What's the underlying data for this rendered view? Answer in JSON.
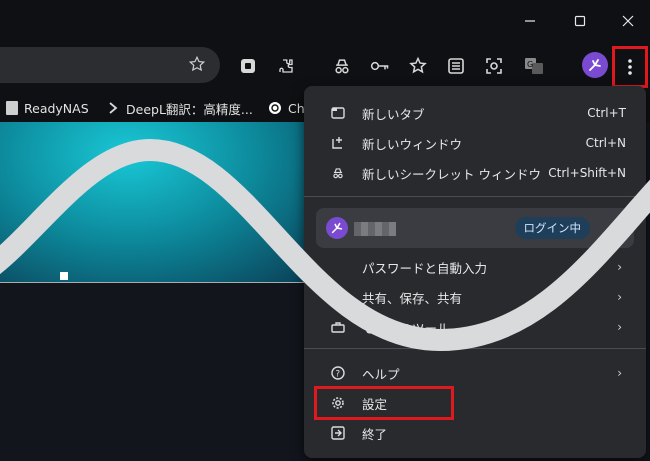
{
  "window_controls": {
    "minimize_icon": "minimize-icon",
    "maximize_icon": "maximize-icon",
    "close_icon": "close-icon"
  },
  "toolbar": {
    "icons": [
      "bookmark-star-icon",
      "extension-icon",
      "puzzle-icon",
      "incognito-icon",
      "key-icon",
      "star-list-icon",
      "reading-list-icon",
      "screenshot-icon",
      "translate-icon",
      "profile-avatar",
      "more-menu-icon"
    ]
  },
  "bookmarks": [
    {
      "label": "ReadyNAS",
      "icon": "file-icon"
    },
    {
      "label": "DeepL翻訳：高精度...",
      "icon": "deepl-icon"
    },
    {
      "label": "Ch",
      "icon": "openai-icon"
    }
  ],
  "menu": {
    "items_top": [
      {
        "label": "新しいタブ",
        "shortcut": "Ctrl+T",
        "icon": "new-tab-icon"
      },
      {
        "label": "新しいウィンドウ",
        "shortcut": "Ctrl+N",
        "icon": "new-window-icon"
      },
      {
        "label": "新しいシークレット ウィンドウ",
        "shortcut": "Ctrl+Shift+N",
        "icon": "incognito-icon"
      }
    ],
    "profile": {
      "status": "ログイン中"
    },
    "items_mid": [
      {
        "label": "パスワードと自動入力",
        "icon": "key-icon"
      },
      {
        "label": "共有、保存、共有",
        "icon": "save-share-icon"
      },
      {
        "label": "その他のツール",
        "icon": "tools-icon"
      }
    ],
    "items_bottom": [
      {
        "label": "ヘルプ",
        "icon": "help-icon"
      },
      {
        "label": "設定",
        "icon": "gear-icon"
      },
      {
        "label": "終了",
        "icon": "exit-icon"
      }
    ]
  },
  "colors": {
    "highlight": "#e0191f",
    "menu_bg": "#282a2e",
    "login_pill": "#1f3e5a"
  }
}
